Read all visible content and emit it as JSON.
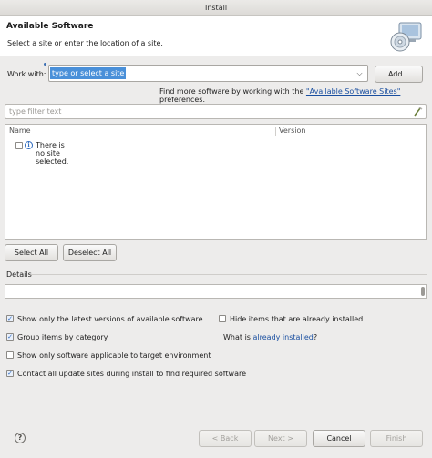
{
  "window": {
    "title": "Install"
  },
  "banner": {
    "title": "Available Software",
    "subtitle": "Select a site or enter the location of a site.",
    "icon": "install-software-cd-icon"
  },
  "work_with": {
    "label": "Work with:",
    "value": "type or select a site",
    "add_label": "Add..."
  },
  "find_more": {
    "prefix": "Find more software by working with the ",
    "link": "\"Available Software Sites\"",
    "suffix": " preferences."
  },
  "filter": {
    "placeholder": "type filter text"
  },
  "table": {
    "columns": [
      "Name",
      "Version"
    ],
    "rows": [
      {
        "name": "There is no site selected.",
        "version": ""
      }
    ]
  },
  "buttons": {
    "select_all": "Select All",
    "deselect_all": "Deselect All",
    "back": "< Back",
    "next": "Next >",
    "cancel": "Cancel",
    "finish": "Finish"
  },
  "details": {
    "label": "Details"
  },
  "options": {
    "latest_versions": {
      "label": "Show only the latest versions of available software",
      "checked": true
    },
    "group_by_category": {
      "label": "Group items by category",
      "checked": true
    },
    "applicable_only": {
      "label": "Show only software applicable to target environment",
      "checked": false
    },
    "contact_all": {
      "label": "Contact all update sites during install to find required software",
      "checked": true
    },
    "hide_installed": {
      "label": "Hide items that are already installed",
      "checked": false
    }
  },
  "what_is": {
    "prefix": "What is ",
    "link": "already installed",
    "suffix": "?"
  },
  "colors": {
    "selection": "#4a90d9",
    "link": "#1a4fa0",
    "background": "#edeceb"
  }
}
